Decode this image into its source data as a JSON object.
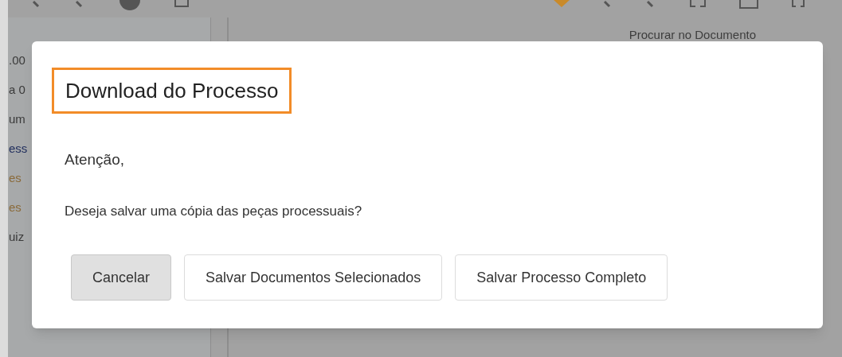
{
  "toolbar": {
    "search_label": "Procurar no Documento"
  },
  "sidebar": {
    "items": [
      {
        "text": ".00",
        "color": "#3a3a3a"
      },
      {
        "text": "a 0",
        "color": "#3a3a3a"
      },
      {
        "text": "um",
        "color": "#3a3a3a"
      },
      {
        "text": "ess",
        "color": "#1f2d5c"
      },
      {
        "text": "es",
        "color": "#8a6a3a"
      },
      {
        "text": "es",
        "color": "#8a6a3a"
      },
      {
        "text": "uiz",
        "color": "#3a3a3a"
      }
    ]
  },
  "dialog": {
    "title": "Download do Processo",
    "title_highlighted": true,
    "greeting": "Atenção,",
    "message": "Deseja salvar uma cópia das peças processuais?",
    "buttons": [
      {
        "label": "Cancelar",
        "selected": true
      },
      {
        "label": "Salvar Documentos Selecionados",
        "selected": false
      },
      {
        "label": "Salvar Processo Completo",
        "selected": false
      }
    ]
  }
}
